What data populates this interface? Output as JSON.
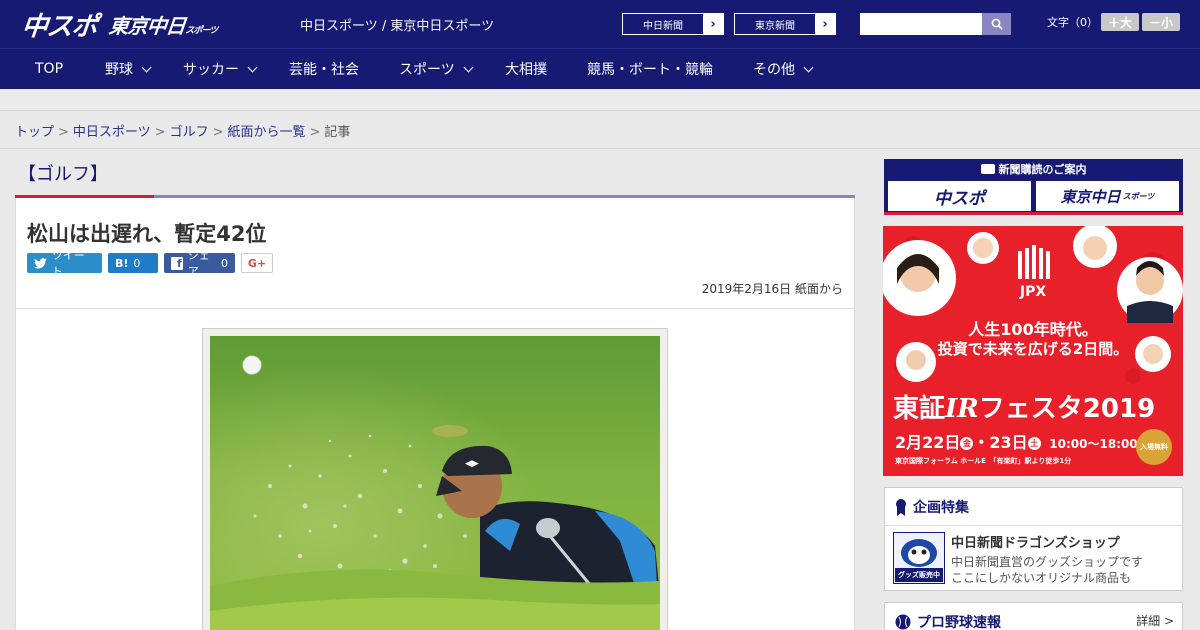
{
  "header": {
    "logo_main": "中スポ",
    "logo_tokyo": "東京中日",
    "logo_tokyo_small": "スポーツ",
    "site_title": "中日スポーツ / 東京中日スポーツ",
    "links": [
      "中日新聞",
      "東京新聞"
    ],
    "search_placeholder": "",
    "font_size_label": "文字（0）",
    "font_larger": "＋大",
    "font_smaller": "－小"
  },
  "nav": {
    "items": [
      {
        "label": "TOP",
        "dropdown": false
      },
      {
        "label": "野球",
        "dropdown": true
      },
      {
        "label": "サッカー",
        "dropdown": true
      },
      {
        "label": "芸能・社会",
        "dropdown": false
      },
      {
        "label": "スポーツ",
        "dropdown": true
      },
      {
        "label": "大相撲",
        "dropdown": false
      },
      {
        "label": "競馬・ボート・競輪",
        "dropdown": false
      },
      {
        "label": "その他",
        "dropdown": true
      }
    ]
  },
  "breadcrumb": {
    "items": [
      "トップ",
      "中日スポーツ",
      "ゴルフ",
      "紙面から一覧"
    ],
    "current": "記事",
    "separator": ">"
  },
  "article": {
    "category": "【ゴルフ】",
    "title": "松山は出遅れ、暫定42位",
    "date": "2019年2月16日 紙面から",
    "share": {
      "tweet": "ツイート",
      "hatena_count": "0",
      "facebook": "シェア",
      "facebook_count": "0",
      "gplus": "G+"
    }
  },
  "sidebar": {
    "subscribe": {
      "heading": "新聞購読のご案内",
      "button_1": "中スポ",
      "button_2": "東京中日",
      "button_2_small": "スポーツ"
    },
    "ad": {
      "brand": "JPX",
      "line1": "人生100年時代。",
      "line2": "投資で未来を広げる2日間。",
      "event": "東証",
      "event_ir": "IR",
      "event_rest": "フェスタ2019",
      "dates": "2月22日",
      "day1": "金",
      "dates2": "・23日",
      "day2": "土",
      "time": "10:00〜18:00",
      "venue": "東京国際フォーラム ホールE　「有楽町」駅より徒歩1分",
      "free": "入場無料"
    },
    "feature": {
      "heading": "企画特集",
      "item_title": "中日新聞ドラゴンズショップ",
      "item_desc1": "中日新聞直営のグッズショップです",
      "item_desc2": "ここにしかないオリジナル商品も",
      "item_thumb": "グッズ販売中"
    },
    "baseball": {
      "heading": "プロ野球速報",
      "more": "詳細 >"
    }
  },
  "colors": {
    "brand_navy": "#161a73",
    "accent_red": "#d81a3c",
    "accent_purple": "#8684c2"
  },
  "icons": [
    "search-icon",
    "chevron-right-icon",
    "chevron-down-icon",
    "twitter-icon",
    "hatena-icon",
    "facebook-icon",
    "gplus-icon",
    "ribbon-icon",
    "baseball-icon"
  ]
}
